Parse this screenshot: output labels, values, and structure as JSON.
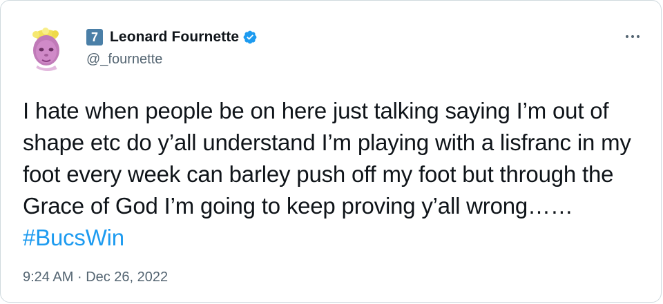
{
  "author": {
    "team_number": "7",
    "display_name": "Leonard Fournette",
    "handle": "@_fournette",
    "verified": true,
    "avatar_icon": "avatar-photo"
  },
  "tweet": {
    "text": "I hate when people be on here just talking saying I’m out of shape etc do y’all understand I’m playing with a lisfranc in my foot every week can barley push off my foot but through the Grace of God I’m going to keep proving y’all wrong……",
    "hashtag": "#BucsWin",
    "time": "9:24 AM",
    "separator": "·",
    "date": "Dec 26, 2022"
  },
  "menu": {
    "icon": "more-options-icon"
  },
  "colors": {
    "link": "#1d9bf0",
    "secondary_text": "#536471",
    "primary_text": "#0f1419",
    "team_badge": "#4a7fa7"
  }
}
